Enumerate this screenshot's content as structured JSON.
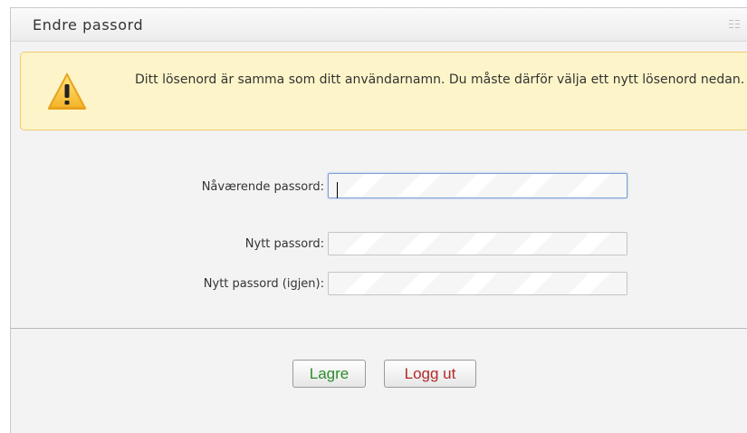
{
  "panel": {
    "title": "Endre passord",
    "drag_icon": "grip-icon"
  },
  "warning": {
    "icon": "warning-triangle-icon",
    "message": "Ditt lösenord är samma som ditt användarnamn. Du måste därför välja ett nytt lösenord nedan."
  },
  "form": {
    "current_password_label": "Nåværende passord:",
    "current_password_value": "",
    "new_password_label": "Nytt passord:",
    "new_password_value": "",
    "confirm_password_label": "Nytt passord (igjen):",
    "confirm_password_value": ""
  },
  "actions": {
    "save_label": "Lagre",
    "logout_label": "Logg ut"
  },
  "colors": {
    "save_text": "#2c8c2c",
    "logout_text": "#b12a2a",
    "warning_bg": "#fdf5c9",
    "warning_border": "#f0c96c"
  }
}
